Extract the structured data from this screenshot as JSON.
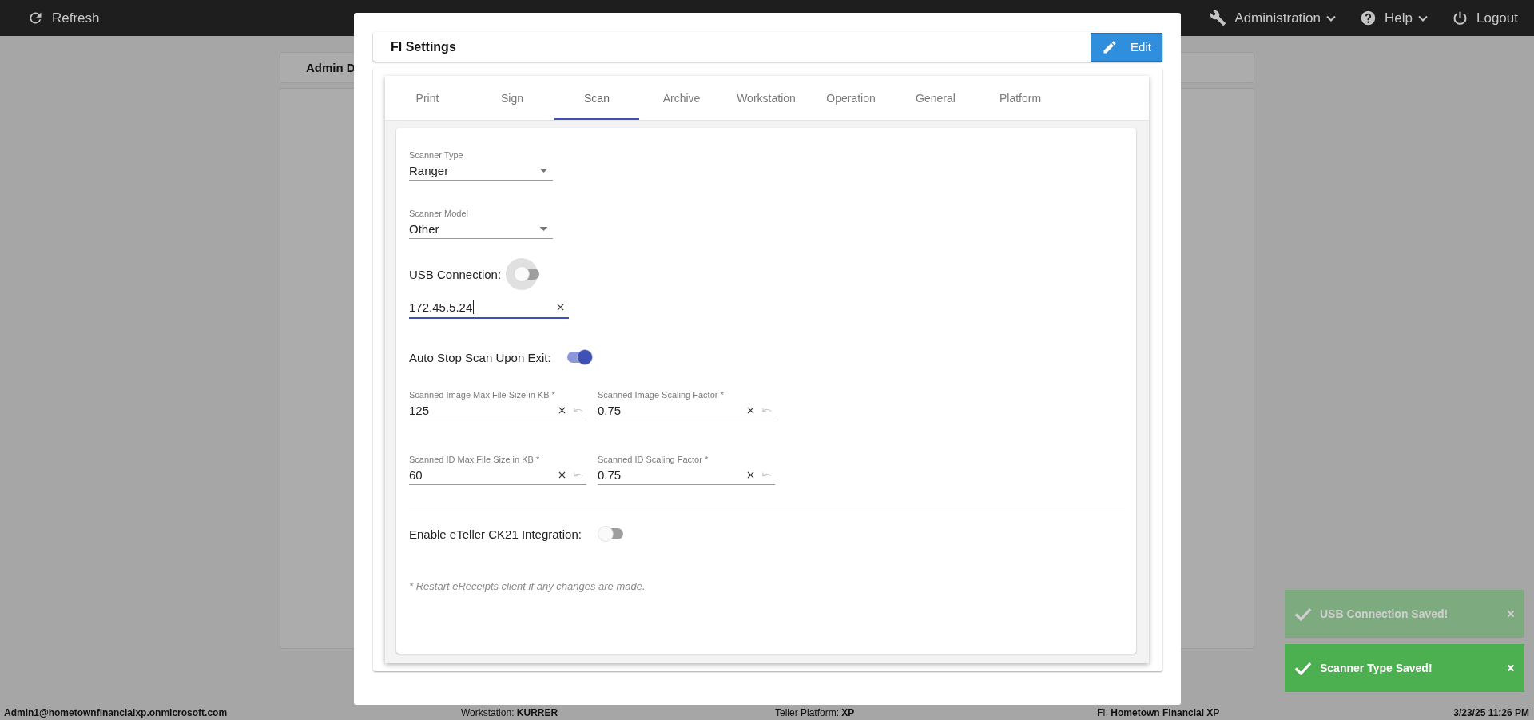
{
  "top_bar": {
    "refresh": "Refresh",
    "menus": [
      {
        "kind": "wrench",
        "label": "Administration",
        "dropdown": true
      },
      {
        "kind": "help",
        "label": "Help",
        "dropdown": true
      },
      {
        "kind": "power",
        "label": "Logout",
        "dropdown": false
      }
    ]
  },
  "background_card": {
    "title": "Admin D"
  },
  "dialog": {
    "title": "FI Settings",
    "edit_button": "Edit",
    "tabs": [
      {
        "label": "Print",
        "selected": false
      },
      {
        "label": "Sign",
        "selected": false
      },
      {
        "label": "Scan",
        "selected": true
      },
      {
        "label": "Archive",
        "selected": false
      },
      {
        "label": "Workstation",
        "selected": false
      },
      {
        "label": "Operation",
        "selected": false
      },
      {
        "label": "General",
        "selected": false
      },
      {
        "label": "Platform",
        "selected": false
      }
    ],
    "form": {
      "selects": [
        {
          "label": "Scanner Type",
          "value": "Ranger"
        },
        {
          "label": "Scanner Model",
          "value": "Other"
        }
      ],
      "usb_connection": {
        "label": "USB Connection:",
        "on": false,
        "focused": true
      },
      "address_field": {
        "value": "172.45.5.24",
        "focused": true
      },
      "auto_stop": {
        "label": "Auto Stop Scan Upon Exit:",
        "on": true,
        "focused": false
      },
      "size_fields": [
        {
          "label": "Scanned Image Max File Size in KB *",
          "value": "125"
        },
        {
          "label": "Scanned Image Scaling Factor *",
          "value": "0.75"
        },
        {
          "label": "Scanned ID Max File Size in KB *",
          "value": "60"
        },
        {
          "label": "Scanned ID Scaling Factor *",
          "value": "0.75"
        }
      ],
      "eteller": {
        "label": "Enable eTeller CK21 Integration:",
        "on": false,
        "focused": false
      },
      "note": "* Restart eReceipts client if any changes are made."
    }
  },
  "toasts": [
    {
      "message": "USB Connection Saved!",
      "faded": true
    },
    {
      "message": "Scanner Type Saved!",
      "faded": false
    }
  ],
  "status_bar": {
    "user": "Admin1@hometownfinancialxp.onmicrosoft.com",
    "workstation": "Workstation: **KURRER**",
    "platform": "Teller Platform: **XP**",
    "fi": "FI: **Hometown Financial XP**",
    "datetime": "3/23/25 11:26 PM"
  }
}
